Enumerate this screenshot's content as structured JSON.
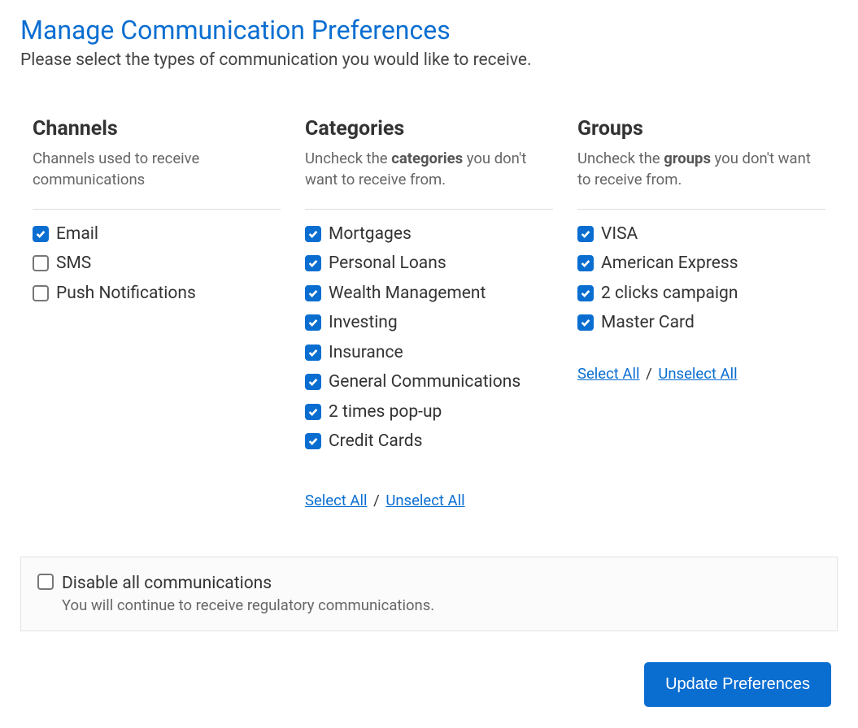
{
  "title": "Manage Communication Preferences",
  "subtitle": "Please select the types of communication you would like to receive.",
  "channels": {
    "heading": "Channels",
    "sub": "Channels used to receive communications",
    "items": [
      {
        "label": "Email",
        "checked": true
      },
      {
        "label": "SMS",
        "checked": false
      },
      {
        "label": "Push Notifications",
        "checked": false
      }
    ]
  },
  "categories": {
    "heading": "Categories",
    "sub_pre": "Uncheck the ",
    "sub_bold": "categories",
    "sub_post": " you don't want to receive from.",
    "items": [
      {
        "label": "Mortgages",
        "checked": true
      },
      {
        "label": "Personal Loans",
        "checked": true
      },
      {
        "label": "Wealth Management",
        "checked": true
      },
      {
        "label": "Investing",
        "checked": true
      },
      {
        "label": "Insurance",
        "checked": true
      },
      {
        "label": "General Communications",
        "checked": true
      },
      {
        "label": "2 times pop-up",
        "checked": true
      },
      {
        "label": "Credit Cards",
        "checked": true
      }
    ],
    "select_all": "Select All",
    "unselect_all": "Unselect All"
  },
  "groups": {
    "heading": "Groups",
    "sub_pre": "Uncheck the ",
    "sub_bold": "groups",
    "sub_post": " you don't want to receive from.",
    "items": [
      {
        "label": "VISA",
        "checked": true
      },
      {
        "label": "American Express",
        "checked": true
      },
      {
        "label": "2 clicks campaign",
        "checked": true
      },
      {
        "label": "Master Card",
        "checked": true
      }
    ],
    "select_all": "Select All",
    "unselect_all": "Unselect All"
  },
  "disable": {
    "label": "Disable all communications",
    "sub": "You will continue to receive regulatory communications.",
    "checked": false
  },
  "update_button": "Update Preferences",
  "divider": "/"
}
